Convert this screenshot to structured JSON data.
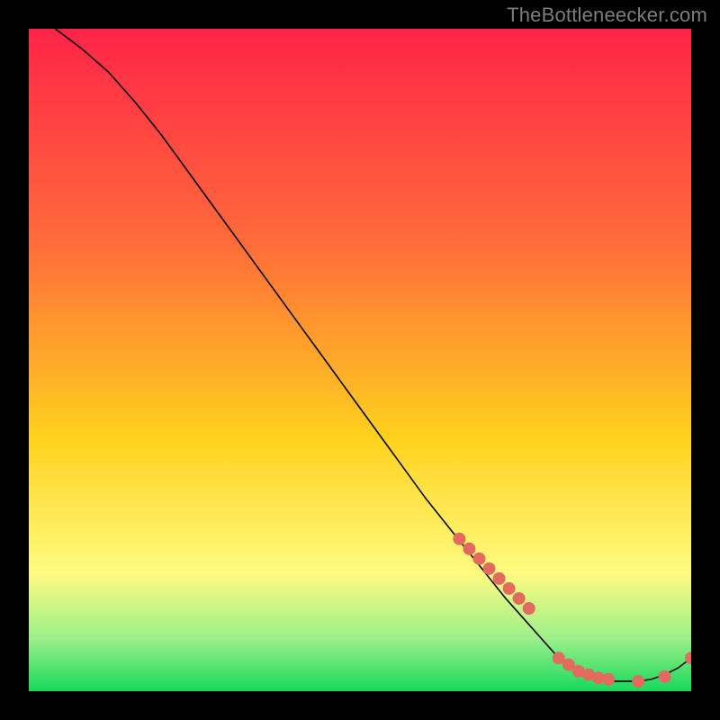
{
  "watermark": "TheBottleneecker.com",
  "colors": {
    "gradient_top": "#ff2448",
    "gradient_mid1": "#ff6a3a",
    "gradient_mid2": "#ffd21e",
    "gradient_low": "#fffb80",
    "gradient_band": "#9cf08a",
    "gradient_bottom": "#17d85a",
    "line": "#000000",
    "marker": "#e26a5e",
    "background": "#000000",
    "watermark_text": "#7d7d7d"
  },
  "chart_data": {
    "type": "line",
    "title": "",
    "xlabel": "",
    "ylabel": "",
    "xlim": [
      0,
      100
    ],
    "ylim": [
      0,
      100
    ],
    "series": [
      {
        "name": "curve",
        "x": [
          4,
          8,
          12,
          16,
          20,
          24,
          28,
          32,
          36,
          40,
          44,
          48,
          52,
          56,
          60,
          64,
          68,
          72,
          76,
          80,
          82,
          84,
          86,
          88,
          90,
          92,
          94,
          96,
          98,
          100
        ],
        "y": [
          100,
          97,
          93.5,
          89,
          84,
          78.5,
          73,
          67.5,
          62,
          56.5,
          51,
          45.5,
          40,
          34.5,
          29,
          24,
          19,
          14,
          9.5,
          5,
          3.5,
          2.5,
          2,
          1.5,
          1.5,
          1.5,
          1.8,
          2.5,
          3.5,
          5
        ]
      }
    ],
    "markers": {
      "name": "highlighted-points",
      "x": [
        65,
        66.5,
        68,
        69.5,
        71,
        72.5,
        74,
        75.5,
        80,
        81.5,
        83,
        84.5,
        86,
        87.5,
        92,
        96,
        100
      ],
      "y": [
        23,
        21.5,
        20,
        18.5,
        17,
        15.5,
        14,
        12.5,
        5,
        4,
        3,
        2.5,
        2,
        1.8,
        1.5,
        2.2,
        5
      ]
    }
  }
}
